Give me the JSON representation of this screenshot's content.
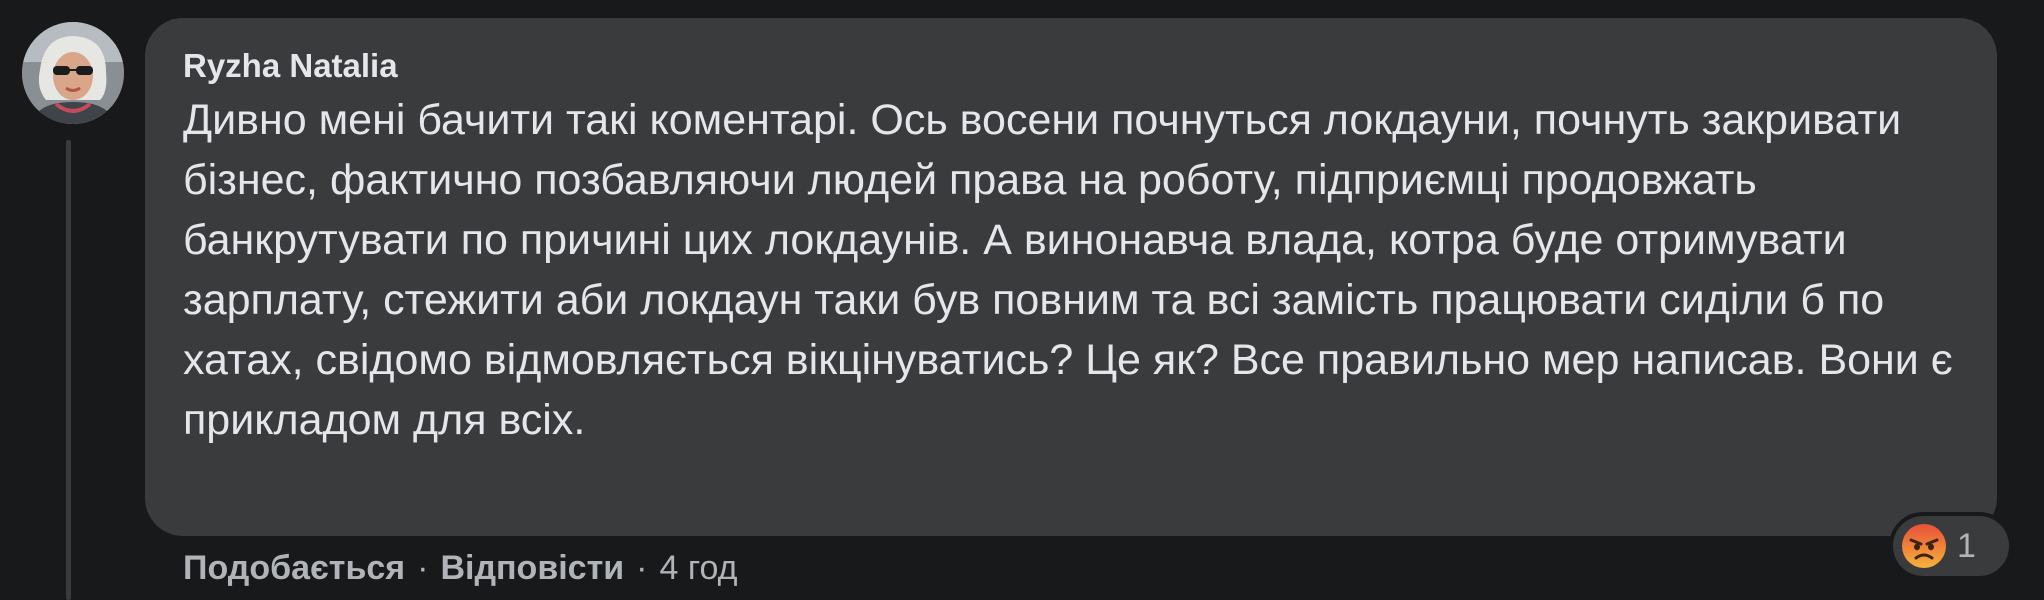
{
  "comment": {
    "author": "Ryzha Natalia",
    "text": "Дивно мені бачити такі коментарі. Ось восени почнуться локдауни, почнуть закривати бізнес, фактично позбавляючи людей права на роботу, підприємці продовжать банкрутувати по причині цих локдаунів. А винонавча влада, котра буде отримувати зарплату, стежити аби локдаун таки був повним та всі замість працювати сиділи б по хатах, свідомо відмовляється вікцінуватись? Це як? Все правильно мер написав. Вони є прикладом для всіх.",
    "avatar_icon": "user-avatar-photo"
  },
  "actions": {
    "like_label": "Подобається",
    "separator": "·",
    "reply_label": "Відповісти",
    "timestamp": "4 год"
  },
  "reactions": {
    "icon": "angry-face-icon",
    "count": "1"
  },
  "colors": {
    "background": "#18191a",
    "bubble": "#3a3b3c",
    "text_primary": "#e4e6eb",
    "text_secondary": "#b0b3b8",
    "angry_reaction": "#f0713a"
  }
}
